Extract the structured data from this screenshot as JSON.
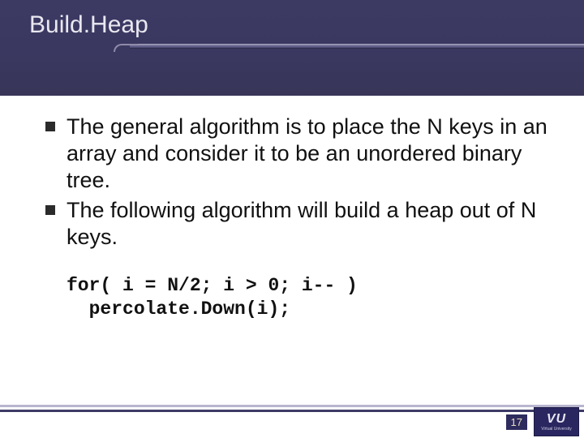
{
  "title": "Build.Heap",
  "bullets": [
    "The general algorithm is to place the N keys in an array and consider it to be an unordered binary tree.",
    "The following algorithm will build a heap out of N keys."
  ],
  "code": {
    "line1": "for( i = N/2; i > 0; i-- )",
    "line2": "  percolate.Down(i);"
  },
  "page_number": "17",
  "logo": {
    "main": "VU",
    "sub": "Virtual University"
  }
}
